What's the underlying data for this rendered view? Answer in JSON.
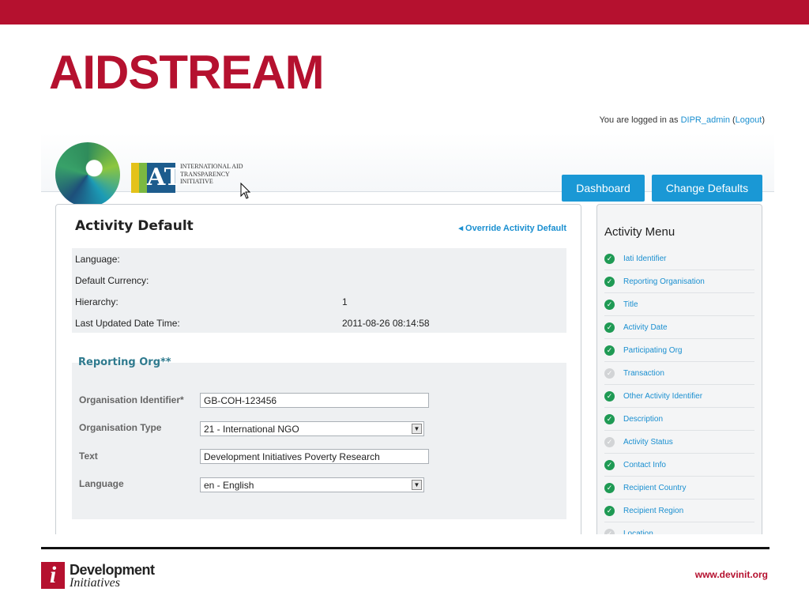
{
  "slide": {
    "title": "AIDSTREAM",
    "footer_logo": {
      "line1": "Development",
      "line2": "Initiatives",
      "mark": "i"
    },
    "footer_url": "www.devinit.org",
    "colors": {
      "brand_red": "#b5112f",
      "button_blue": "#1a98d5",
      "link_blue": "#1a8fd0",
      "check_green": "#1f9a54"
    }
  },
  "app": {
    "login": {
      "prefix": "You are logged in as",
      "user": "DIPR_admin",
      "open_paren": "(",
      "logout": "Logout",
      "close_paren": ")"
    },
    "logo": {
      "globe_icon": "iati-globe-icon",
      "mark_text": "ATI",
      "name": "INTERNATIONAL AID TRANSPARENCY INITIATIVE"
    },
    "buttons": {
      "dashboard": "Dashboard",
      "change_defaults": "Change Defaults"
    }
  },
  "activity_default": {
    "title": "Activity Default",
    "override_link": "Override Activity Default",
    "info": [
      {
        "label": "Language:",
        "value": ""
      },
      {
        "label": "Default Currency:",
        "value": ""
      },
      {
        "label": "Hierarchy:",
        "value": "1"
      },
      {
        "label": "Last Updated Date Time:",
        "value": "2011-08-26 08:14:58"
      }
    ],
    "reporting_org": {
      "title": "Reporting Org**",
      "fields": [
        {
          "label": "Organisation Identifier*",
          "value": "GB-COH-123456"
        },
        {
          "label": "Organisation Type",
          "value": "21 - International NGO"
        },
        {
          "label": "Text",
          "value": "Development Initiatives Poverty Research"
        },
        {
          "label": "Language",
          "value": "en - English"
        }
      ]
    }
  },
  "activity_menu": {
    "title": "Activity Menu",
    "items": [
      {
        "label": "Iati Identifier",
        "done": true
      },
      {
        "label": "Reporting Organisation",
        "done": true
      },
      {
        "label": "Title",
        "done": true
      },
      {
        "label": "Activity Date",
        "done": true
      },
      {
        "label": "Participating Org",
        "done": true
      },
      {
        "label": "Transaction",
        "done": false
      },
      {
        "label": "Other Activity Identifier",
        "done": true
      },
      {
        "label": "Description",
        "done": true
      },
      {
        "label": "Activity Status",
        "done": false
      },
      {
        "label": "Contact Info",
        "done": true
      },
      {
        "label": "Recipient Country",
        "done": true
      },
      {
        "label": "Recipient Region",
        "done": true
      },
      {
        "label": "Location",
        "done": false
      }
    ]
  }
}
